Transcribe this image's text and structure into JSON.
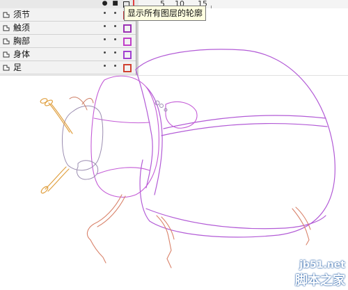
{
  "timeline": {
    "header_icons": [
      "eye-icon",
      "lock-icon",
      "outline-icon"
    ],
    "ruler_numbers": [
      "5",
      "10",
      "15"
    ],
    "layers": [
      {
        "name": "须节",
        "outline_color": "#c23b3b"
      },
      {
        "name": "触须",
        "outline_color": "#9b30b4"
      },
      {
        "name": "胸部",
        "outline_color": "#c03ec8"
      },
      {
        "name": "身体",
        "outline_color": "#a140d0"
      },
      {
        "name": "足",
        "outline_color": "#d04030"
      }
    ]
  },
  "tooltip": {
    "text": "显示所有图层的轮廓"
  },
  "colors": {
    "body_outline": "#b25ad6",
    "leg_outline": "#d9826a",
    "antenna_outline": "#e0a040"
  },
  "watermark": {
    "site": "jb51.net",
    "brand": "脚本之家"
  }
}
